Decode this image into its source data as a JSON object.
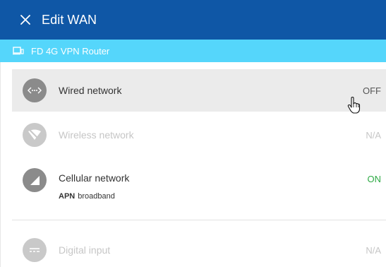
{
  "header": {
    "title": "Edit WAN",
    "close_icon": "close-icon"
  },
  "device": {
    "name": "FD 4G VPN Router",
    "icon": "router-icon"
  },
  "networks": [
    {
      "label": "Wired network",
      "status": "OFF",
      "icon": "ethernet-icon",
      "enabled": true,
      "hovered": true
    },
    {
      "label": "Wireless network",
      "status": "N/A",
      "icon": "wifi-off-icon",
      "enabled": false
    },
    {
      "label": "Cellular network",
      "status": "ON",
      "icon": "cellular-signal-icon",
      "enabled": true,
      "sub_key": "APN",
      "sub_value": "broadband"
    },
    {
      "label": "Digital input",
      "status": "N/A",
      "icon": "digital-input-icon",
      "enabled": false
    }
  ],
  "colors": {
    "header_bg": "#0f57a6",
    "device_bar_bg": "#55d6fb",
    "status_on": "#2eaa45",
    "status_off": "#555555",
    "disabled_text": "#c6c6c6",
    "icon_active": "#8b8b8b",
    "icon_disabled": "#c9c9c9"
  }
}
